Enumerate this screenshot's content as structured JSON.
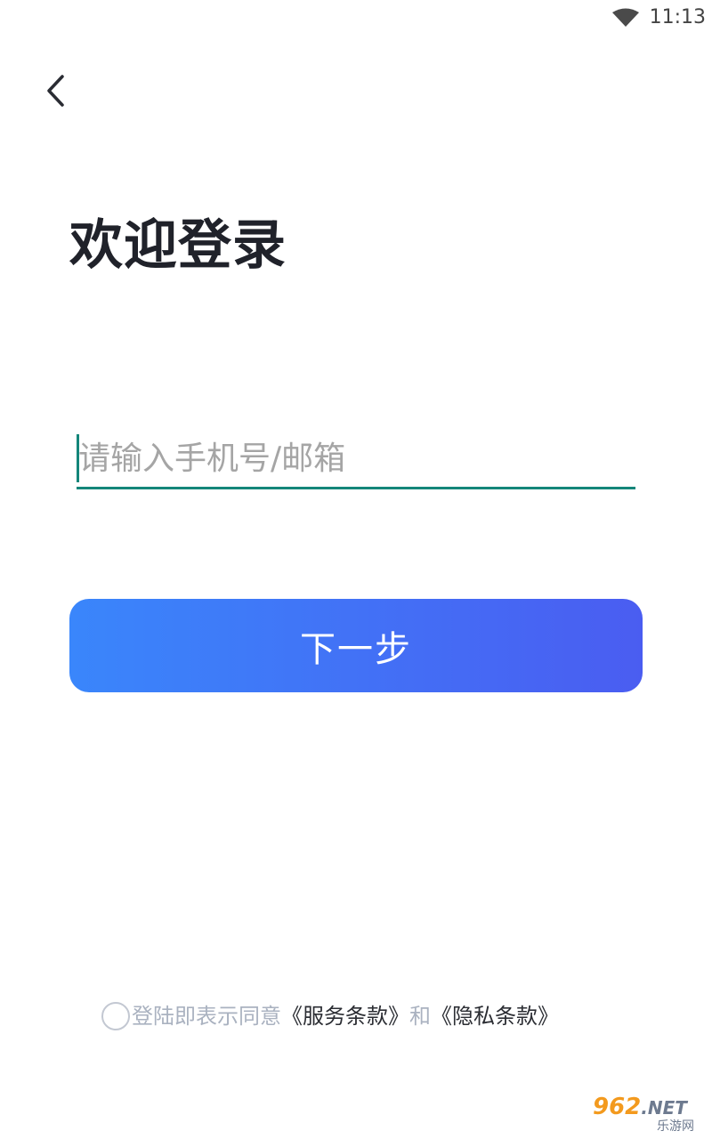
{
  "status_bar": {
    "time": "11:13",
    "wifi_icon": "wifi-icon"
  },
  "header": {
    "back_icon": "chevron-left-icon"
  },
  "main": {
    "title": "欢迎登录",
    "account_input": {
      "value": "",
      "placeholder": "请输入手机号/邮箱"
    },
    "next_button_label": "下一步"
  },
  "agreement": {
    "prefix": "登陆即表示同意",
    "terms_link": "《服务条款》",
    "conjunction": "和",
    "privacy_link": "《隐私条款》",
    "checked": false
  },
  "watermark": {
    "brand_number": "962",
    "brand_suffix": ".NET",
    "brand_sub": "乐游网"
  },
  "colors": {
    "accent": "#14867a",
    "button_gradient_start": "#3a86fb",
    "button_gradient_end": "#4a5df1",
    "title_text": "#20222a",
    "muted_text": "#aab2c0",
    "placeholder_text": "#a5a5a5"
  }
}
